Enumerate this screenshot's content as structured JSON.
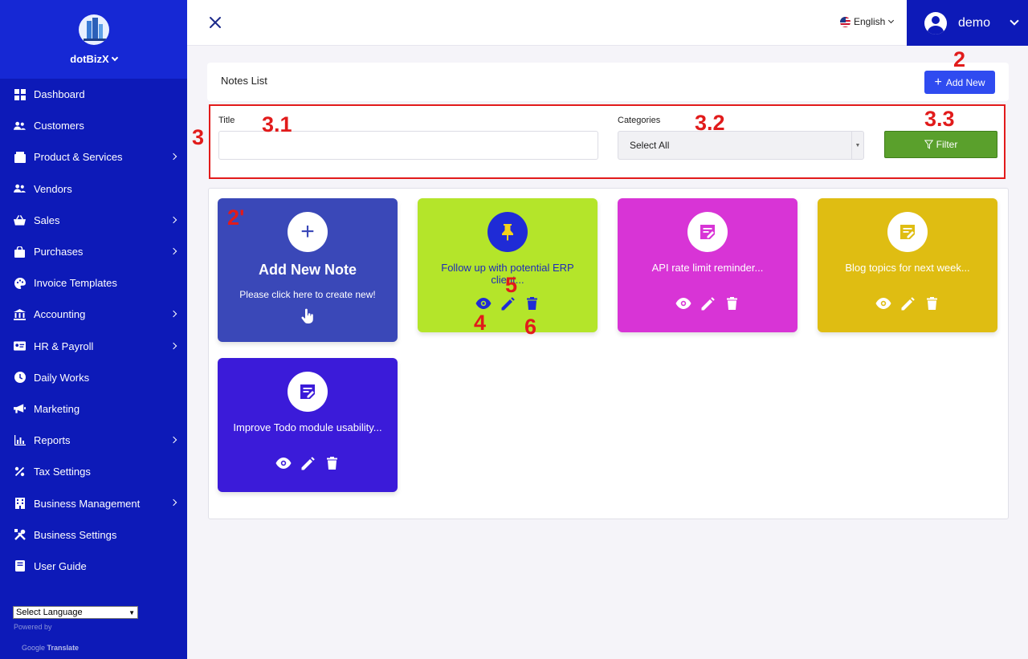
{
  "brand": {
    "name": "dotBizX"
  },
  "sidebar": {
    "items": [
      {
        "label": "Dashboard",
        "icon": "dashboard-icon",
        "has_submenu": false
      },
      {
        "label": "Customers",
        "icon": "users-icon",
        "has_submenu": false
      },
      {
        "label": "Product & Services",
        "icon": "box-icon",
        "has_submenu": true
      },
      {
        "label": "Vendors",
        "icon": "users-icon",
        "has_submenu": false
      },
      {
        "label": "Sales",
        "icon": "basket-icon",
        "has_submenu": true
      },
      {
        "label": "Purchases",
        "icon": "bag-icon",
        "has_submenu": true
      },
      {
        "label": "Invoice Templates",
        "icon": "palette-icon",
        "has_submenu": false
      },
      {
        "label": "Accounting",
        "icon": "bank-icon",
        "has_submenu": true
      },
      {
        "label": "HR & Payroll",
        "icon": "id-card-icon",
        "has_submenu": true
      },
      {
        "label": "Daily Works",
        "icon": "clock-icon",
        "has_submenu": false
      },
      {
        "label": "Marketing",
        "icon": "megaphone-icon",
        "has_submenu": false
      },
      {
        "label": "Reports",
        "icon": "chart-icon",
        "has_submenu": true
      },
      {
        "label": "Tax Settings",
        "icon": "percent-icon",
        "has_submenu": false
      },
      {
        "label": "Business Management",
        "icon": "building-icon",
        "has_submenu": true
      },
      {
        "label": "Business Settings",
        "icon": "tools-icon",
        "has_submenu": false
      },
      {
        "label": "User Guide",
        "icon": "book-icon",
        "has_submenu": false
      }
    ],
    "language_select": "Select Language",
    "powered_by": "Powered by",
    "google_translate": {
      "google": "Google",
      "translate": "Translate"
    }
  },
  "topbar": {
    "language": "English",
    "user_name": "demo"
  },
  "header": {
    "title": "Notes List",
    "add_button": "Add New"
  },
  "filter": {
    "title_label": "Title",
    "title_value": "",
    "categories_label": "Categories",
    "categories_value": "Select All",
    "filter_button": "Filter"
  },
  "add_note_card": {
    "title": "Add New Note",
    "subtitle": "Please click here to create new!"
  },
  "notes": [
    {
      "title": "Follow up with potential ERP client...",
      "color": "#b4e52a",
      "text_color": "#1f2bb8",
      "icon": "pin-icon",
      "icon_bg": "#1f2bd6",
      "icon_fg": "#f4d21b",
      "action_color": "#1f2bd6"
    },
    {
      "title": "API rate limit reminder...",
      "color": "#d834d6",
      "text_color": "#ffffff",
      "icon": "note-icon",
      "icon_bg": "#ffffff",
      "icon_fg": "#d834d6",
      "action_color": "#ffffff"
    },
    {
      "title": "Blog topics for next week...",
      "color": "#dfbd12",
      "text_color": "#ffffff",
      "icon": "note-icon",
      "icon_bg": "#ffffff",
      "icon_fg": "#dfbd12",
      "action_color": "#ffffff"
    },
    {
      "title": "Improve Todo module usability...",
      "color": "#3b1bd9",
      "text_color": "#ffffff",
      "icon": "note-icon",
      "icon_bg": "#ffffff",
      "icon_fg": "#3b1bd9",
      "action_color": "#ffffff"
    }
  ],
  "annotations": {
    "a2": "2",
    "a2p": "2'",
    "a3": "3",
    "a31": "3.1",
    "a32": "3.2",
    "a33": "3.3",
    "a4": "4",
    "a5": "5",
    "a6": "6"
  },
  "colors": {
    "sidebar_bg": "#0d1ab8",
    "brand_bg": "#1628d4",
    "primary_button": "#2f4bf0",
    "filter_button": "#5aa02c",
    "annotation_red": "#e11b1b"
  }
}
